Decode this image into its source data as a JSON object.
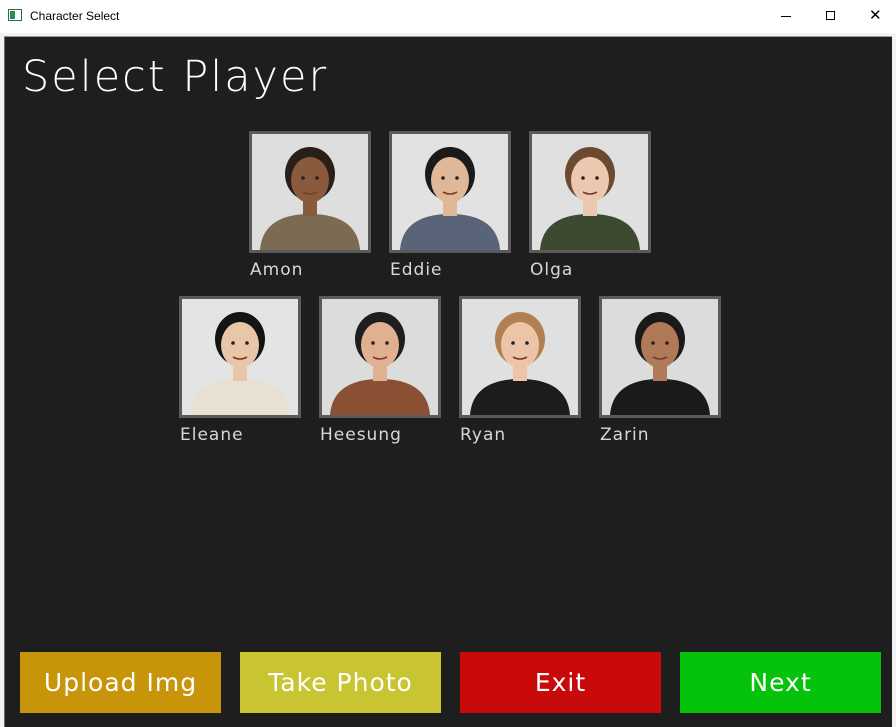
{
  "window": {
    "title": "Character Select",
    "icon": "app-window-icon",
    "controls": {
      "minimize": "–",
      "maximize": "☐",
      "close": "✕"
    }
  },
  "heading": "Select Player",
  "players": [
    {
      "name": "Amon",
      "icon": "photo-amon",
      "shirt": "#7a6b52",
      "skin": "#8a5a3c",
      "hair": "#2a1f18",
      "bg": "#dedede"
    },
    {
      "name": "Eddie",
      "icon": "photo-eddie",
      "shirt": "#5a6478",
      "skin": "#e0b898",
      "hair": "#1a1a1a",
      "bg": "#e2e2e2"
    },
    {
      "name": "Olga",
      "icon": "photo-olga",
      "shirt": "#3d4a32",
      "skin": "#ecc8b0",
      "hair": "#6b4a30",
      "bg": "#e0e0e0"
    },
    {
      "name": "Eleane",
      "icon": "photo-eleane",
      "shirt": "#e8e0d0",
      "skin": "#e8c6a8",
      "hair": "#141414",
      "bg": "#e4e4e4"
    },
    {
      "name": "Heesung",
      "icon": "photo-heesung",
      "shirt": "#8a5034",
      "skin": "#e0b090",
      "hair": "#1e1e1e",
      "bg": "#dcdcdc"
    },
    {
      "name": "Ryan",
      "icon": "photo-ryan",
      "shirt": "#1c1c1c",
      "skin": "#eec4a8",
      "hair": "#b08050",
      "bg": "#e0e0e0"
    },
    {
      "name": "Zarin",
      "icon": "photo-zarin",
      "shirt": "#1a1a1a",
      "skin": "#b07a58",
      "hair": "#1a1a1a",
      "bg": "#dcdcdc"
    }
  ],
  "buttons": {
    "upload": {
      "label": "Upload Img",
      "color": "#c8940a"
    },
    "take": {
      "label": "Take Photo",
      "color": "#c9c432"
    },
    "exit": {
      "label": "Exit",
      "color": "#c80a0a"
    },
    "next": {
      "label": "Next",
      "color": "#04c30a"
    }
  }
}
